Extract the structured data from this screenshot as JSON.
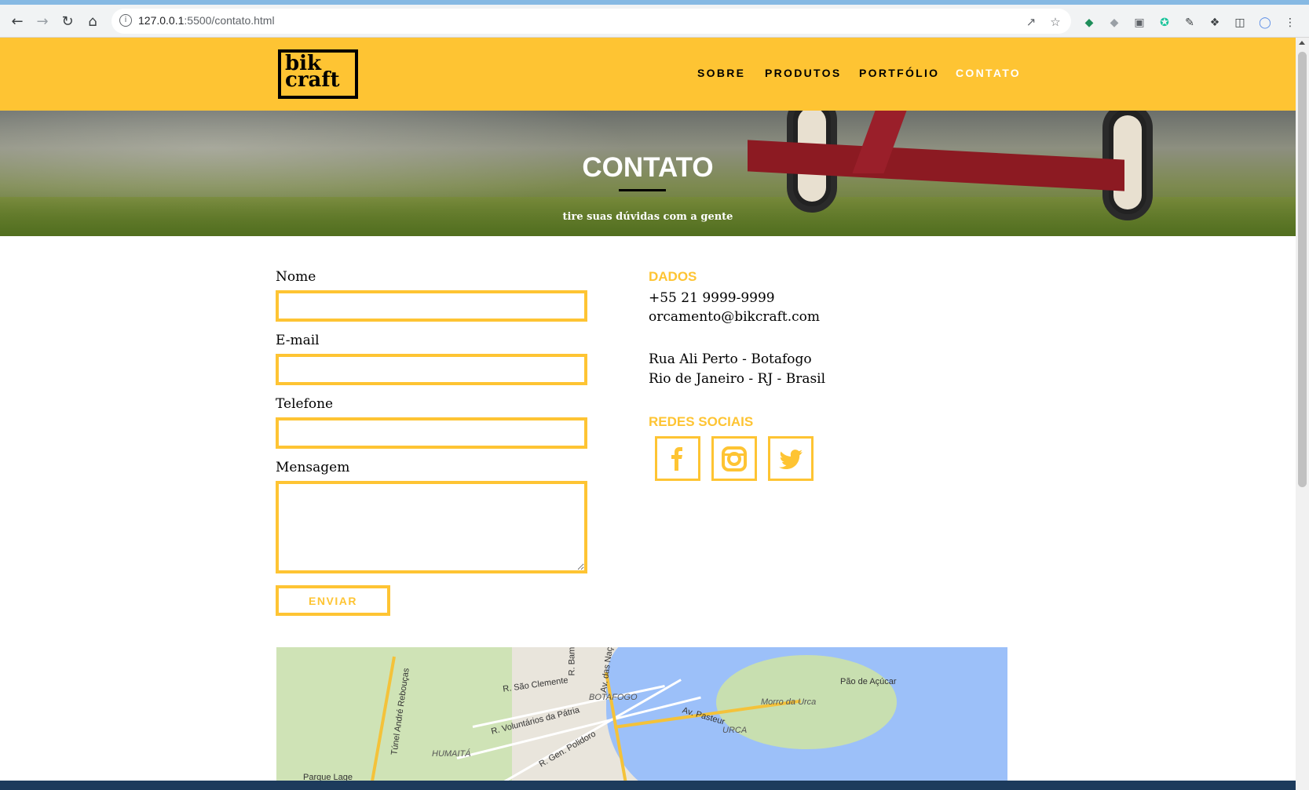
{
  "browser": {
    "url_host": "127.0.0.1",
    "url_path": ":5500/contato.html"
  },
  "header": {
    "logo_line1": "bik",
    "logo_line2": "craft",
    "nav": [
      "SOBRE",
      "PRODUTOS",
      "PORTFÓLIO",
      "CONTATO"
    ],
    "active_nav": "CONTATO"
  },
  "hero": {
    "title": "CONTATO",
    "subtitle": "tire suas dúvidas com a gente"
  },
  "form": {
    "name_label": "Nome",
    "email_label": "E-mail",
    "phone_label": "Telefone",
    "message_label": "Mensagem",
    "submit_label": "ENVIAR"
  },
  "info": {
    "dados_title": "DADOS",
    "phone": "+55 21 9999-9999",
    "email": "orcamento@bikcraft.com",
    "address_line1": "Rua Ali Perto - Botafogo",
    "address_line2": "Rio de Janeiro - RJ - Brasil",
    "social_title": "REDES SOCIAIS",
    "social": [
      "facebook",
      "instagram",
      "twitter"
    ]
  },
  "map": {
    "labels": [
      "R. São Clemente",
      "R. Voluntários da Pátria",
      "BOTAFOGO",
      "Av. Pasteur",
      "URCA",
      "Morro da Urca",
      "Pão de Açúcar",
      "HUMAITÁ",
      "R. Gen. Polidoro",
      "Túnel André Rebouças",
      "Av. das Nações",
      "Parque Lage",
      "R. Bam"
    ]
  },
  "colors": {
    "brand_yellow": "#fec433"
  }
}
